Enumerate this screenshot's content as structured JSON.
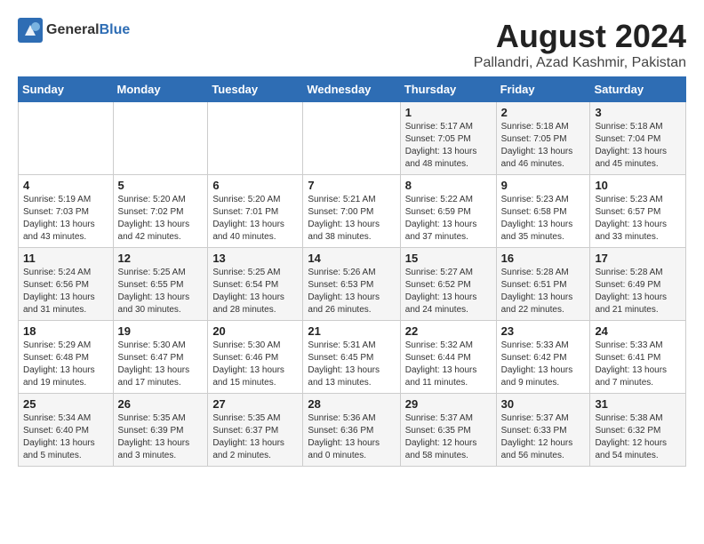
{
  "header": {
    "logo_general": "General",
    "logo_blue": "Blue",
    "month_year": "August 2024",
    "location": "Pallandri, Azad Kashmir, Pakistan"
  },
  "weekdays": [
    "Sunday",
    "Monday",
    "Tuesday",
    "Wednesday",
    "Thursday",
    "Friday",
    "Saturday"
  ],
  "weeks": [
    [
      {
        "day": "",
        "info": ""
      },
      {
        "day": "",
        "info": ""
      },
      {
        "day": "",
        "info": ""
      },
      {
        "day": "",
        "info": ""
      },
      {
        "day": "1",
        "info": "Sunrise: 5:17 AM\nSunset: 7:05 PM\nDaylight: 13 hours\nand 48 minutes."
      },
      {
        "day": "2",
        "info": "Sunrise: 5:18 AM\nSunset: 7:05 PM\nDaylight: 13 hours\nand 46 minutes."
      },
      {
        "day": "3",
        "info": "Sunrise: 5:18 AM\nSunset: 7:04 PM\nDaylight: 13 hours\nand 45 minutes."
      }
    ],
    [
      {
        "day": "4",
        "info": "Sunrise: 5:19 AM\nSunset: 7:03 PM\nDaylight: 13 hours\nand 43 minutes."
      },
      {
        "day": "5",
        "info": "Sunrise: 5:20 AM\nSunset: 7:02 PM\nDaylight: 13 hours\nand 42 minutes."
      },
      {
        "day": "6",
        "info": "Sunrise: 5:20 AM\nSunset: 7:01 PM\nDaylight: 13 hours\nand 40 minutes."
      },
      {
        "day": "7",
        "info": "Sunrise: 5:21 AM\nSunset: 7:00 PM\nDaylight: 13 hours\nand 38 minutes."
      },
      {
        "day": "8",
        "info": "Sunrise: 5:22 AM\nSunset: 6:59 PM\nDaylight: 13 hours\nand 37 minutes."
      },
      {
        "day": "9",
        "info": "Sunrise: 5:23 AM\nSunset: 6:58 PM\nDaylight: 13 hours\nand 35 minutes."
      },
      {
        "day": "10",
        "info": "Sunrise: 5:23 AM\nSunset: 6:57 PM\nDaylight: 13 hours\nand 33 minutes."
      }
    ],
    [
      {
        "day": "11",
        "info": "Sunrise: 5:24 AM\nSunset: 6:56 PM\nDaylight: 13 hours\nand 31 minutes."
      },
      {
        "day": "12",
        "info": "Sunrise: 5:25 AM\nSunset: 6:55 PM\nDaylight: 13 hours\nand 30 minutes."
      },
      {
        "day": "13",
        "info": "Sunrise: 5:25 AM\nSunset: 6:54 PM\nDaylight: 13 hours\nand 28 minutes."
      },
      {
        "day": "14",
        "info": "Sunrise: 5:26 AM\nSunset: 6:53 PM\nDaylight: 13 hours\nand 26 minutes."
      },
      {
        "day": "15",
        "info": "Sunrise: 5:27 AM\nSunset: 6:52 PM\nDaylight: 13 hours\nand 24 minutes."
      },
      {
        "day": "16",
        "info": "Sunrise: 5:28 AM\nSunset: 6:51 PM\nDaylight: 13 hours\nand 22 minutes."
      },
      {
        "day": "17",
        "info": "Sunrise: 5:28 AM\nSunset: 6:49 PM\nDaylight: 13 hours\nand 21 minutes."
      }
    ],
    [
      {
        "day": "18",
        "info": "Sunrise: 5:29 AM\nSunset: 6:48 PM\nDaylight: 13 hours\nand 19 minutes."
      },
      {
        "day": "19",
        "info": "Sunrise: 5:30 AM\nSunset: 6:47 PM\nDaylight: 13 hours\nand 17 minutes."
      },
      {
        "day": "20",
        "info": "Sunrise: 5:30 AM\nSunset: 6:46 PM\nDaylight: 13 hours\nand 15 minutes."
      },
      {
        "day": "21",
        "info": "Sunrise: 5:31 AM\nSunset: 6:45 PM\nDaylight: 13 hours\nand 13 minutes."
      },
      {
        "day": "22",
        "info": "Sunrise: 5:32 AM\nSunset: 6:44 PM\nDaylight: 13 hours\nand 11 minutes."
      },
      {
        "day": "23",
        "info": "Sunrise: 5:33 AM\nSunset: 6:42 PM\nDaylight: 13 hours\nand 9 minutes."
      },
      {
        "day": "24",
        "info": "Sunrise: 5:33 AM\nSunset: 6:41 PM\nDaylight: 13 hours\nand 7 minutes."
      }
    ],
    [
      {
        "day": "25",
        "info": "Sunrise: 5:34 AM\nSunset: 6:40 PM\nDaylight: 13 hours\nand 5 minutes."
      },
      {
        "day": "26",
        "info": "Sunrise: 5:35 AM\nSunset: 6:39 PM\nDaylight: 13 hours\nand 3 minutes."
      },
      {
        "day": "27",
        "info": "Sunrise: 5:35 AM\nSunset: 6:37 PM\nDaylight: 13 hours\nand 2 minutes."
      },
      {
        "day": "28",
        "info": "Sunrise: 5:36 AM\nSunset: 6:36 PM\nDaylight: 13 hours\nand 0 minutes."
      },
      {
        "day": "29",
        "info": "Sunrise: 5:37 AM\nSunset: 6:35 PM\nDaylight: 12 hours\nand 58 minutes."
      },
      {
        "day": "30",
        "info": "Sunrise: 5:37 AM\nSunset: 6:33 PM\nDaylight: 12 hours\nand 56 minutes."
      },
      {
        "day": "31",
        "info": "Sunrise: 5:38 AM\nSunset: 6:32 PM\nDaylight: 12 hours\nand 54 minutes."
      }
    ]
  ]
}
